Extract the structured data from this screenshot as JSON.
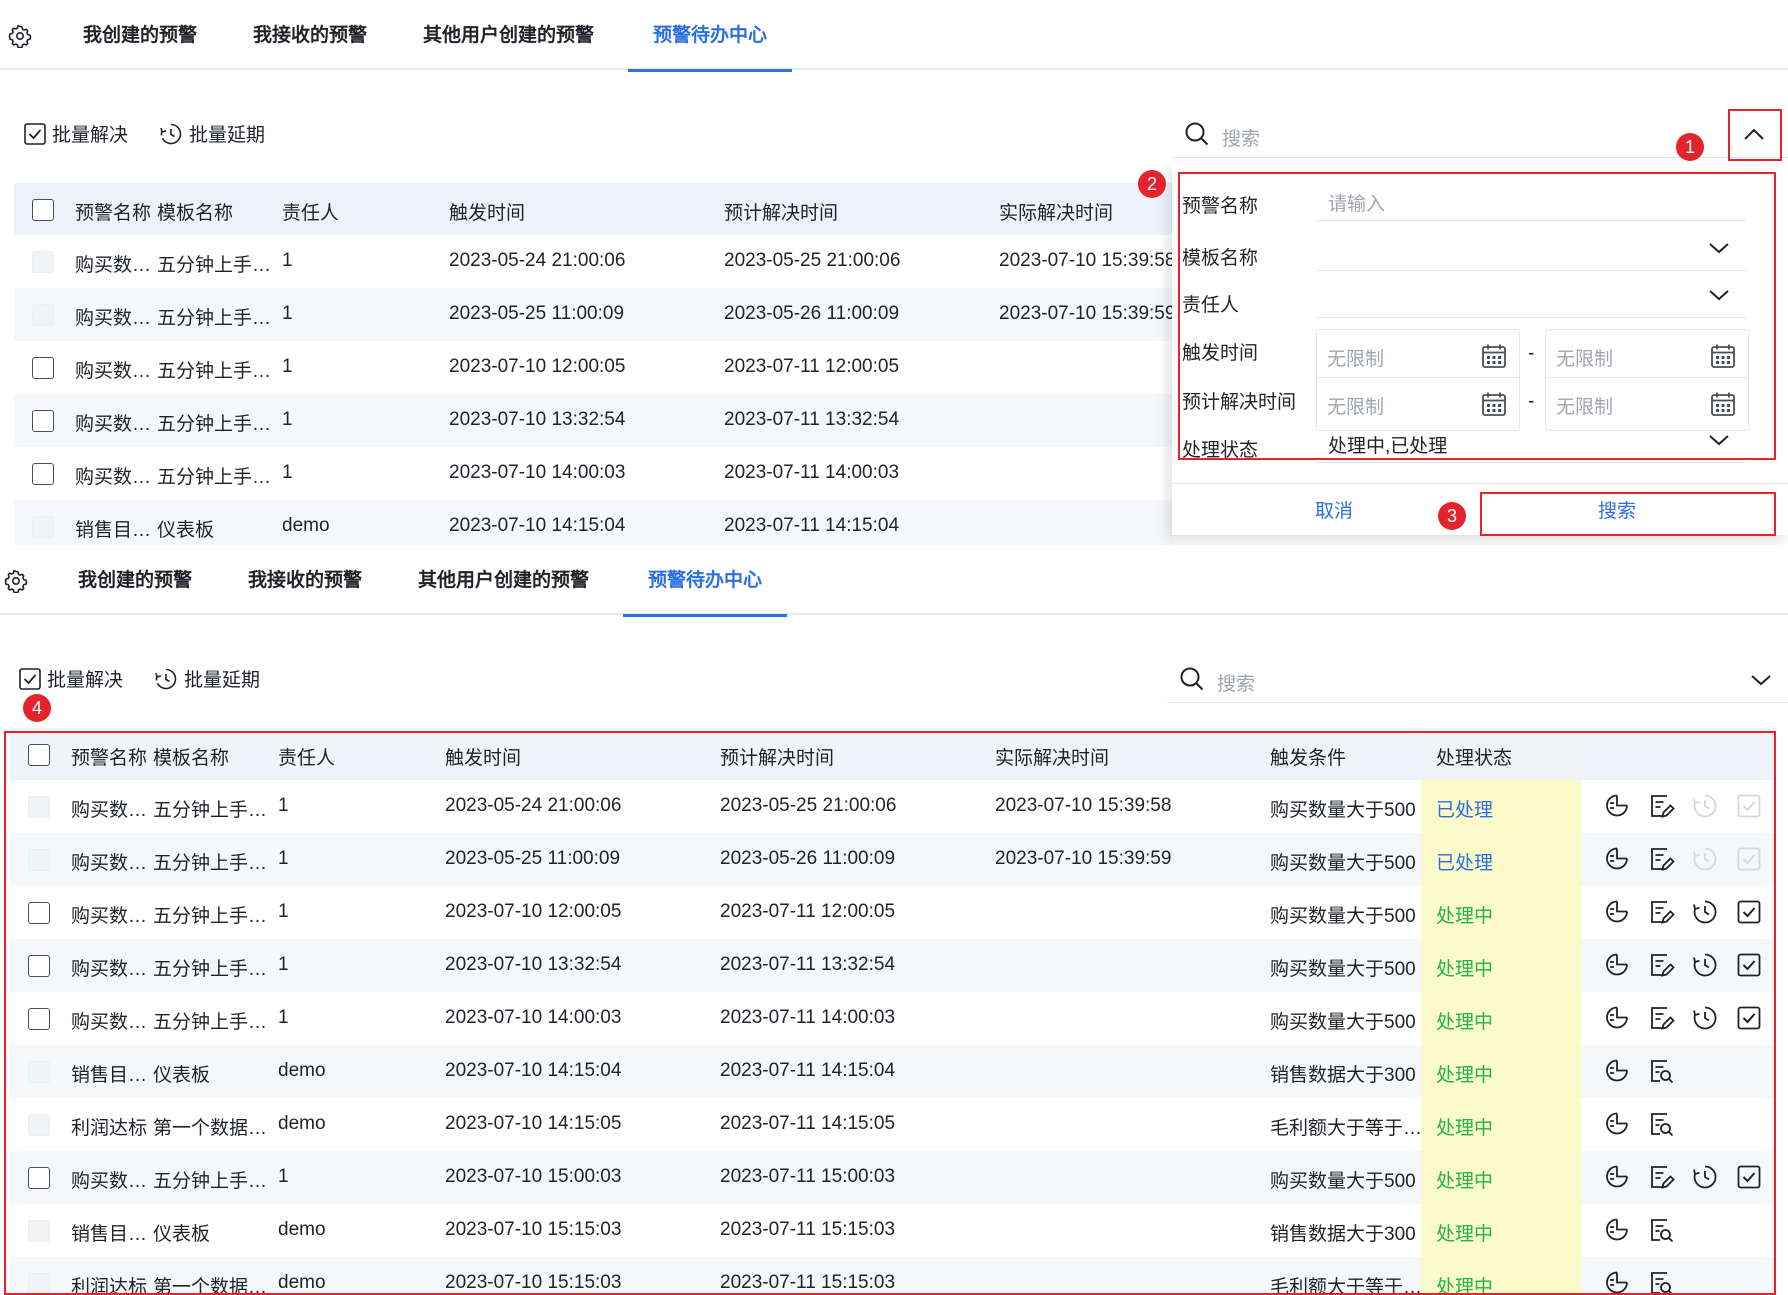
{
  "tabs": [
    {
      "label": "我创建的预警",
      "active": false
    },
    {
      "label": "我接收的预警",
      "active": false
    },
    {
      "label": "其他用户创建的预警",
      "active": false
    },
    {
      "label": "预警待办中心",
      "active": true
    }
  ],
  "toolbar": {
    "batch_resolve": "批量解决",
    "batch_extend": "批量延期"
  },
  "search": {
    "placeholder": "搜索"
  },
  "columns": [
    "预警名称",
    "模板名称",
    "责任人",
    "触发时间",
    "预计解决时间",
    "实际解决时间",
    "触发条件",
    "处理状态"
  ],
  "rows": [
    {
      "name": "购买数…",
      "template": "五分钟上手…",
      "owner": "1",
      "trigger_time": "2023-05-24 21:00:06",
      "expected_time": "2023-05-25 21:00:06",
      "actual_time": "2023-07-10 15:39:58",
      "condition": "购买数量大于500",
      "status": "已处理",
      "selectable": false
    },
    {
      "name": "购买数…",
      "template": "五分钟上手…",
      "owner": "1",
      "trigger_time": "2023-05-25 11:00:09",
      "expected_time": "2023-05-26 11:00:09",
      "actual_time": "2023-07-10 15:39:59",
      "condition": "购买数量大于500",
      "status": "已处理",
      "selectable": false
    },
    {
      "name": "购买数…",
      "template": "五分钟上手…",
      "owner": "1",
      "trigger_time": "2023-07-10 12:00:05",
      "expected_time": "2023-07-11 12:00:05",
      "actual_time": "",
      "condition": "购买数量大于500",
      "status": "处理中",
      "selectable": true
    },
    {
      "name": "购买数…",
      "template": "五分钟上手…",
      "owner": "1",
      "trigger_time": "2023-07-10 13:32:54",
      "expected_time": "2023-07-11 13:32:54",
      "actual_time": "",
      "condition": "购买数量大于500",
      "status": "处理中",
      "selectable": true
    },
    {
      "name": "购买数…",
      "template": "五分钟上手…",
      "owner": "1",
      "trigger_time": "2023-07-10 14:00:03",
      "expected_time": "2023-07-11 14:00:03",
      "actual_time": "",
      "condition": "购买数量大于500",
      "status": "处理中",
      "selectable": true
    },
    {
      "name": "销售目…",
      "template": "仪表板",
      "owner": "demo",
      "trigger_time": "2023-07-10 14:15:04",
      "expected_time": "2023-07-11 14:15:04",
      "actual_time": "",
      "condition": "销售数据大于300",
      "status": "处理中",
      "selectable": false
    },
    {
      "name": "利润达标",
      "template": "第一个数据…",
      "owner": "demo",
      "trigger_time": "2023-07-10 14:15:05",
      "expected_time": "2023-07-11 14:15:05",
      "actual_time": "",
      "condition": "毛利额大于等于…",
      "status": "处理中",
      "selectable": false
    },
    {
      "name": "购买数…",
      "template": "五分钟上手…",
      "owner": "1",
      "trigger_time": "2023-07-10 15:00:03",
      "expected_time": "2023-07-11 15:00:03",
      "actual_time": "",
      "condition": "购买数量大于500",
      "status": "处理中",
      "selectable": true
    },
    {
      "name": "销售目…",
      "template": "仪表板",
      "owner": "demo",
      "trigger_time": "2023-07-10 15:15:03",
      "expected_time": "2023-07-11 15:15:03",
      "actual_time": "",
      "condition": "销售数据大于300",
      "status": "处理中",
      "selectable": false
    },
    {
      "name": "利润达标",
      "template": "第一个数据…",
      "owner": "demo",
      "trigger_time": "2023-07-10 15:15:03",
      "expected_time": "2023-07-11 15:15:03",
      "actual_time": "",
      "condition": "毛利额大于等于…",
      "status": "处理中",
      "selectable": false
    }
  ],
  "filter": {
    "alert_name_label": "预警名称",
    "alert_name_placeholder": "请输入",
    "template_label": "模板名称",
    "owner_label": "责任人",
    "trigger_time_label": "触发时间",
    "expected_time_label": "预计解决时间",
    "status_label": "处理状态",
    "status_value": "处理中,已处理",
    "date_placeholder": "无限制",
    "dash": "-",
    "cancel": "取消",
    "search": "搜索"
  },
  "badges": [
    "1",
    "2",
    "3",
    "4"
  ],
  "colors": {
    "accent": "#2c6fe0",
    "done": "#2c6fe0",
    "doing": "#24b24e",
    "highlight": "#fafbc8",
    "annotation": "#e5232c",
    "header_bg": "#edf2fa"
  }
}
